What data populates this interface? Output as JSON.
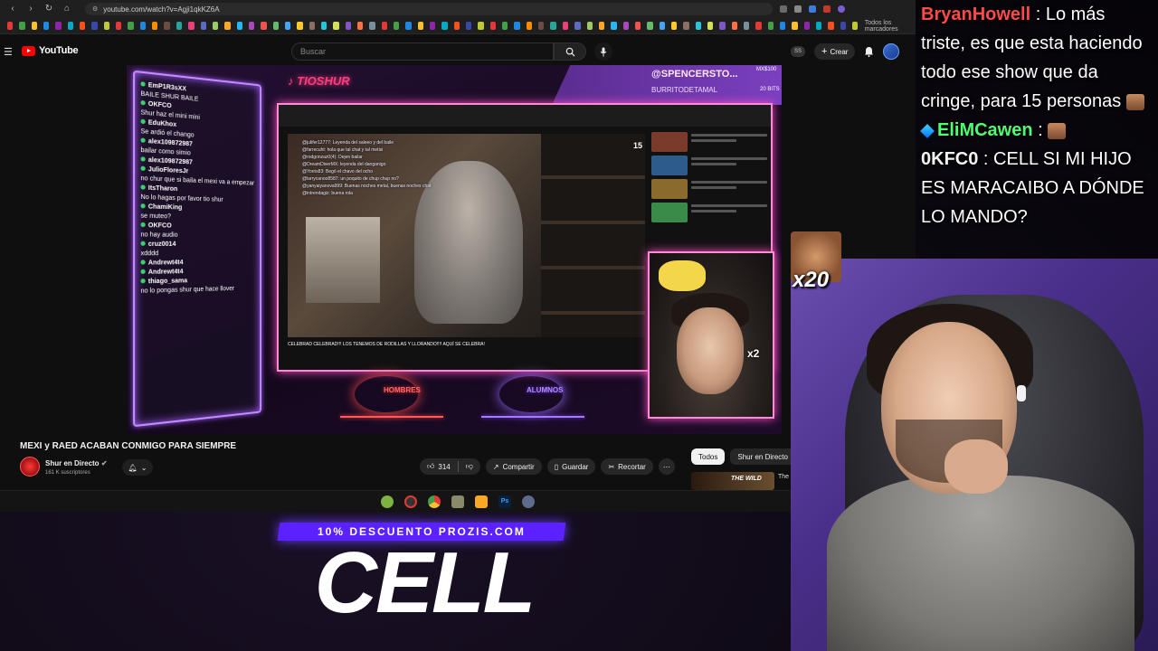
{
  "browser": {
    "url": "youtube.com/watch?v=Agji1qkKZ6A",
    "bookmarks_all_label": "Todos los marcadores"
  },
  "youtube": {
    "logo_text": "YouTube",
    "search_placeholder": "Buscar",
    "create_label": "Crear"
  },
  "video_overlay": {
    "brand": "TIOSHUR",
    "donation_user": "@SPENCERSTO...",
    "donation_sub": "BURRITODETAMAL",
    "donation_amount": "MX$100",
    "donation_bits": "20 BITS",
    "mode_left": "HOMBRES",
    "mode_right": "ALUMNOS",
    "inner_caption": "CELEBRAD CELEBRAD!!! LOS TENEMOS DE RODILLAS Y LLORANDO!!!! AQUÍ SE CELEBRA!",
    "cam_multiplier": "x2",
    "view_counter": "15"
  },
  "stream_chat": [
    {
      "user": "EmP1R3sXX",
      "text": "BAILE SHUR BAILE"
    },
    {
      "user": "OKFCO",
      "text": "Shur haz el mini mini"
    },
    {
      "user": "EduKhox",
      "text": "Se ardió el chango"
    },
    {
      "user": "alex109872987",
      "text": "bailar como simio"
    },
    {
      "user": "alex109872987",
      "text": ""
    },
    {
      "user": "JulioFloresJr",
      "text": "no chur que si baila el mexi va a empezar a llover"
    },
    {
      "user": "ItsTharon",
      "text": "No lo hagas por favor tio shur"
    },
    {
      "user": "ChamiKing",
      "text": "se muteo?"
    },
    {
      "user": "OKFCO",
      "text": "no hay audio"
    },
    {
      "user": "cruz0014",
      "text": "xdddd"
    },
    {
      "user": "Andrewt4t4",
      "text": ""
    },
    {
      "user": "Andrewt4t4",
      "text": ""
    },
    {
      "user": "thiago_sama",
      "text": "no lo pongas shur que hace llover"
    }
  ],
  "inner_chat": [
    "@julifer12777: Leyenda del saleeo y del baile",
    "@farrecuht: hola que tal chat y tal metisi",
    "@rodgonzaz0(4): Dejen bailar",
    "@DreamDiverMX: leyenda del danganigo",
    "@Yorris83: Begó el chavo del ocho",
    "@larrycanoo8587: un poquito de chup chup no?",
    "@yanyaiyanova999: Buenas noches metal, buenas noches chat",
    "@intrendagiz: buena rola"
  ],
  "video": {
    "title": "MEXI y RAED ACABAN CONMIGO PARA SIEMPRE",
    "channel": "Shur en Directo",
    "subscribers": "161 K suscriptores",
    "likes": "314",
    "share_label": "Compartir",
    "save_label": "Guardar",
    "clip_label": "Recortar"
  },
  "chips": [
    "Todos",
    "Shur en Directo"
  ],
  "recommended": {
    "thumb_text": "THE WILD",
    "title": "The"
  },
  "promo": {
    "discount": "10% DESCUENTO PROZIS.COM",
    "code": "CELL"
  },
  "overlay_chat": [
    {
      "user": "BryanHowell",
      "color": "red",
      "text": "Lo más triste, es que esta haciendo todo ese show que da cringe, para 15 personas"
    },
    {
      "user": "EliMCawen",
      "color": "green",
      "text": ""
    },
    {
      "user": "0KFC0",
      "color": "white",
      "text": "CELL SI MI HIJO ES MARACAIBO A DÓNDE LO MANDO?"
    }
  ],
  "float_emote_multiplier": "x20",
  "colors": {
    "youtube_red": "#ff0000",
    "neon_pink": "#ff8ad8",
    "neon_purple": "#c58cff",
    "promo_purple": "#5b21ff",
    "chat_red": "#ff4a4a",
    "chat_green": "#4eff72"
  }
}
